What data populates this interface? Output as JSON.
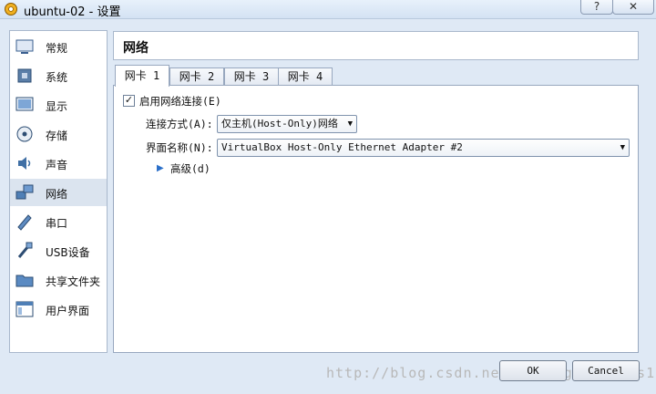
{
  "window": {
    "title": "ubuntu-02 - 设置",
    "help_label": "?",
    "close_label": "✕"
  },
  "sidebar": {
    "items": [
      {
        "label": "常规",
        "icon": "general-icon"
      },
      {
        "label": "系统",
        "icon": "system-icon"
      },
      {
        "label": "显示",
        "icon": "display-icon"
      },
      {
        "label": "存储",
        "icon": "storage-icon"
      },
      {
        "label": "声音",
        "icon": "audio-icon"
      },
      {
        "label": "网络",
        "icon": "network-icon",
        "active": true
      },
      {
        "label": "串口",
        "icon": "serial-port-icon"
      },
      {
        "label": "USB设备",
        "icon": "usb-icon"
      },
      {
        "label": "共享文件夹",
        "icon": "shared-folder-icon"
      },
      {
        "label": "用户界面",
        "icon": "user-interface-icon"
      }
    ]
  },
  "main": {
    "title": "网络",
    "tabs": [
      "网卡 1",
      "网卡 2",
      "网卡 3",
      "网卡 4"
    ],
    "active_tab": 0,
    "enable_label": "启用网络连接(E)",
    "enable_checked": true,
    "attach_label": "连接方式(A):",
    "attach_value": "仅主机(Host-Only)网络",
    "name_label": "界面名称(N):",
    "name_value": "VirtualBox Host-Only Ethernet Adapter #2",
    "advanced_label": "高级(d)"
  },
  "buttons": {
    "ok": "OK",
    "cancel": "Cancel"
  },
  "watermark": "http://blog.csdn.net/dreamgestiones1234",
  "colors": {
    "accent": "#2a6fc9",
    "active_item_bg": "#dbe4ef"
  }
}
